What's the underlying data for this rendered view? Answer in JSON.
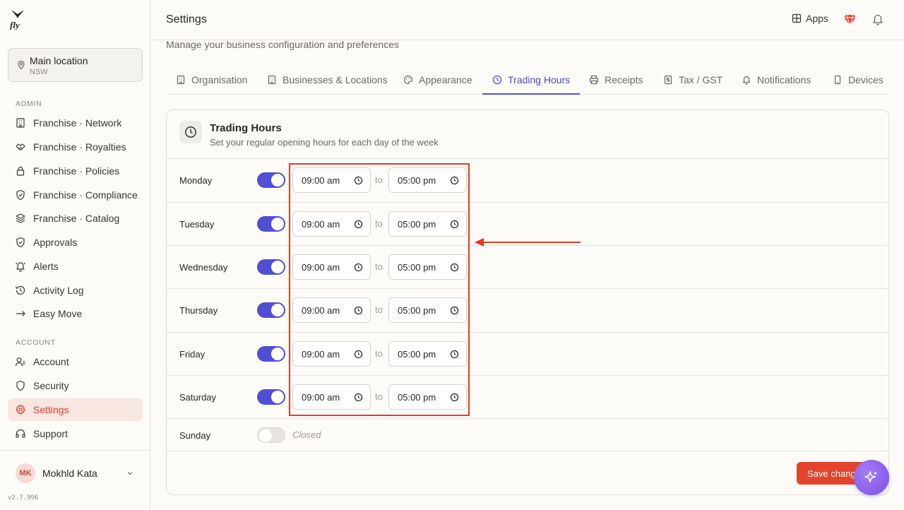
{
  "sidebar": {
    "location": {
      "name": "Main location",
      "state": "NSW"
    },
    "admin_label": "ADMIN",
    "admin_items": [
      {
        "label": "Franchise · Network",
        "icon": "building-icon"
      },
      {
        "label": "Franchise · Royalties",
        "icon": "handshake-icon"
      },
      {
        "label": "Franchise · Policies",
        "icon": "lock-icon"
      },
      {
        "label": "Franchise · Compliance",
        "icon": "shield-check-icon"
      },
      {
        "label": "Franchise · Catalog",
        "icon": "layers-icon"
      },
      {
        "label": "Approvals",
        "icon": "shield-check-icon"
      },
      {
        "label": "Alerts",
        "icon": "bell-ring-icon"
      },
      {
        "label": "Activity Log",
        "icon": "history-icon"
      },
      {
        "label": "Easy Move",
        "icon": "arrow-right-icon"
      }
    ],
    "account_label": "ACCOUNT",
    "account_items": [
      {
        "label": "Account",
        "icon": "user-icon"
      },
      {
        "label": "Security",
        "icon": "shield-icon"
      },
      {
        "label": "Settings",
        "icon": "gear-icon",
        "active": true
      },
      {
        "label": "Support",
        "icon": "headset-icon"
      }
    ],
    "user": {
      "initials": "MK",
      "name": "Mokhld Kata"
    },
    "version": "v2.7.996"
  },
  "header": {
    "title": "Settings",
    "apps_label": "Apps"
  },
  "subtitle": "Manage your business configuration and preferences",
  "tabs": [
    {
      "label": "Organisation"
    },
    {
      "label": "Businesses & Locations"
    },
    {
      "label": "Appearance"
    },
    {
      "label": "Trading Hours",
      "active": true
    },
    {
      "label": "Receipts"
    },
    {
      "label": "Tax / GST"
    },
    {
      "label": "Notifications"
    },
    {
      "label": "Devices"
    }
  ],
  "trading_hours": {
    "title": "Trading Hours",
    "subtitle": "Set your regular opening hours for each day of the week",
    "to_label": "to",
    "closed_label": "Closed",
    "days": [
      {
        "day": "Monday",
        "open": true,
        "start": "09:00  am",
        "end": "05:00  pm"
      },
      {
        "day": "Tuesday",
        "open": true,
        "start": "09:00  am",
        "end": "05:00  pm"
      },
      {
        "day": "Wednesday",
        "open": true,
        "start": "09:00  am",
        "end": "05:00  pm"
      },
      {
        "day": "Thursday",
        "open": true,
        "start": "09:00  am",
        "end": "05:00  pm"
      },
      {
        "day": "Friday",
        "open": true,
        "start": "09:00  am",
        "end": "05:00  pm"
      },
      {
        "day": "Saturday",
        "open": true,
        "start": "09:00  am",
        "end": "05:00  pm"
      },
      {
        "day": "Sunday",
        "open": false
      }
    ],
    "save_label": "Save changes"
  },
  "colors": {
    "accent": "#5150d6",
    "brand": "#e5432d",
    "annotation": "#e03b2a"
  }
}
